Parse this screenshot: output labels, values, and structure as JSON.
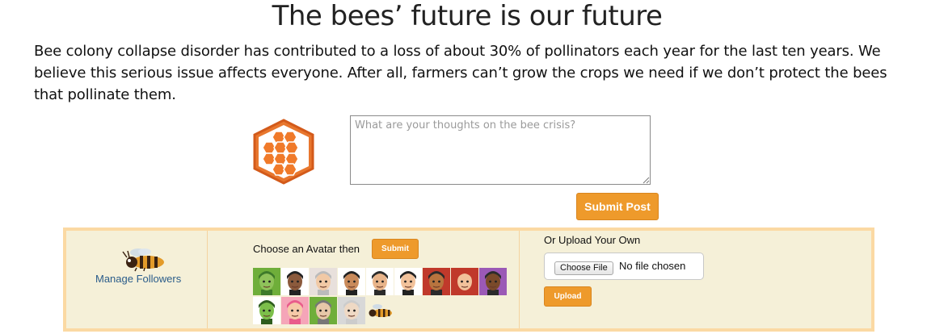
{
  "page": {
    "title": "The bees’ future is our future",
    "intro": "Bee colony collapse disorder has contributed to a loss of about 30% of pollinators each year for the last ten years. We believe this serious issue affects everyone. After all, farmers can’t grow the crops we need if we don’t protect the bees that pollinate them."
  },
  "post_form": {
    "placeholder": "What are your thoughts on the bee crisis?",
    "value": "",
    "submit_label": "Submit Post"
  },
  "followers": {
    "link_label": "Manage Followers"
  },
  "avatar_picker": {
    "label": "Choose an Avatar then",
    "submit_label": "Submit",
    "avatars": [
      {
        "icon": "zombie-avatar",
        "bg": "#6fae3a"
      },
      {
        "icon": "sunglasses-man-avatar",
        "bg": "#ffffff"
      },
      {
        "icon": "grandpa-avatar",
        "bg": "#e8e0dc"
      },
      {
        "icon": "suited-man-avatar",
        "bg": "#ffffff"
      },
      {
        "icon": "bearded-man-avatar",
        "bg": "#ffffff"
      },
      {
        "icon": "spiky-hair-man-avatar",
        "bg": "#ffffff"
      },
      {
        "icon": "bald-bearded-man-avatar",
        "bg": "#c0392b"
      },
      {
        "icon": "hooded-woman-avatar",
        "bg": "#c0392b"
      },
      {
        "icon": "curly-hair-man-avatar",
        "bg": "#9b59b6"
      },
      {
        "icon": "green-zombie-avatar",
        "bg": "#ffffff"
      },
      {
        "icon": "pink-hair-woman-avatar",
        "bg": "#f5a5b8"
      },
      {
        "icon": "gray-haired-woman-avatar",
        "bg": "#6fae3a"
      },
      {
        "icon": "elderly-woman-avatar",
        "bg": "#d8d8d8"
      },
      {
        "icon": "bee-avatar",
        "bg": "#f5f0d8"
      }
    ]
  },
  "upload": {
    "label": "Or Upload Your Own",
    "choose_file_label": "Choose File",
    "file_status": "No file chosen",
    "upload_label": "Upload"
  }
}
